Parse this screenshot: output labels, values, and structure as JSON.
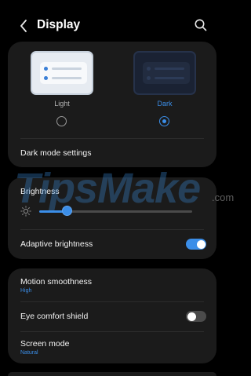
{
  "header": {
    "title": "Display",
    "back_icon": "chevron-left-icon",
    "search_icon": "search-icon"
  },
  "theme": {
    "light_label": "Light",
    "dark_label": "Dark",
    "selected": "Dark",
    "accent_color": "#3b8ee8"
  },
  "card1": {
    "dark_mode_settings": "Dark mode settings"
  },
  "brightness": {
    "label": "Brightness",
    "level": 0.18,
    "icon": "sun-icon"
  },
  "adaptive": {
    "label": "Adaptive brightness",
    "enabled": true
  },
  "motion": {
    "label": "Motion smoothness",
    "value": "High"
  },
  "eye_comfort": {
    "label": "Eye comfort shield",
    "enabled": false
  },
  "screen_mode": {
    "label": "Screen mode",
    "value": "Natural"
  },
  "watermark": {
    "text": "TipsMake",
    "suffix": ".com"
  }
}
